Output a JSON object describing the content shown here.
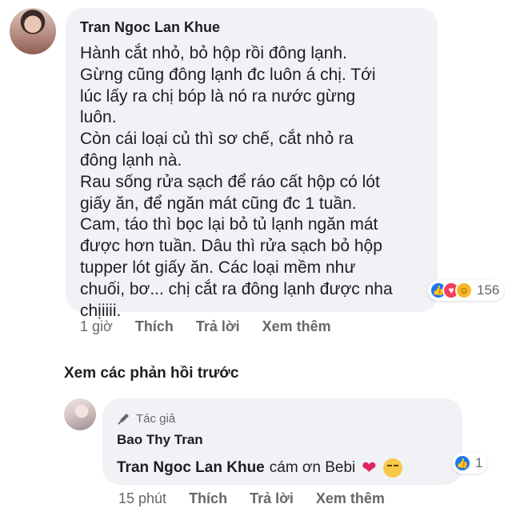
{
  "comment": {
    "author": "Tran Ngoc Lan Khue",
    "text": "Hành cắt nhỏ, bỏ hộp rồi đông lạnh.\nGừng cũng đông lạnh đc luôn á chị. Tới\nlúc lấy ra chị bóp là nó ra nước gừng\nluôn.\nCòn cái loại củ thì sơ chế, cắt nhỏ ra\nđông lạnh nà.\nRau sống rửa sạch để ráo cất hộp có lót\ngiấy ăn, để ngăn mát cũng đc 1 tuần.\nCam, táo thì bọc lại bỏ tủ lạnh ngăn mát\nđược hơn tuần. Dâu thì rửa sạch bỏ hộp\ntupper lót giấy ăn. Các loại mềm như\nchuối, bơ... chị cắt ra đông lạnh được nha\nchịiiii.",
    "reactions": {
      "icons": [
        "like-icon",
        "love-icon",
        "care-icon"
      ],
      "count": "156"
    },
    "time": "1 giờ",
    "like_label": "Thích",
    "reply_label": "Trả lời",
    "more_label": "Xem thêm"
  },
  "view_previous": "Xem các phản hồi trước",
  "reply": {
    "badge": "Tác giả",
    "author": "Bao Thy Tran",
    "mention": "Tran Ngoc Lan Khue",
    "text": "cám ơn Bebi",
    "reactions": {
      "icons": [
        "like-icon"
      ],
      "count": "1"
    },
    "time": "15 phút",
    "like_label": "Thích",
    "reply_label": "Trả lời",
    "more_label": "Xem thêm"
  },
  "colors": {
    "bubble": "#f0f2f5",
    "like": "#1877f2",
    "love": "#f33e58",
    "muted": "#65676b"
  }
}
